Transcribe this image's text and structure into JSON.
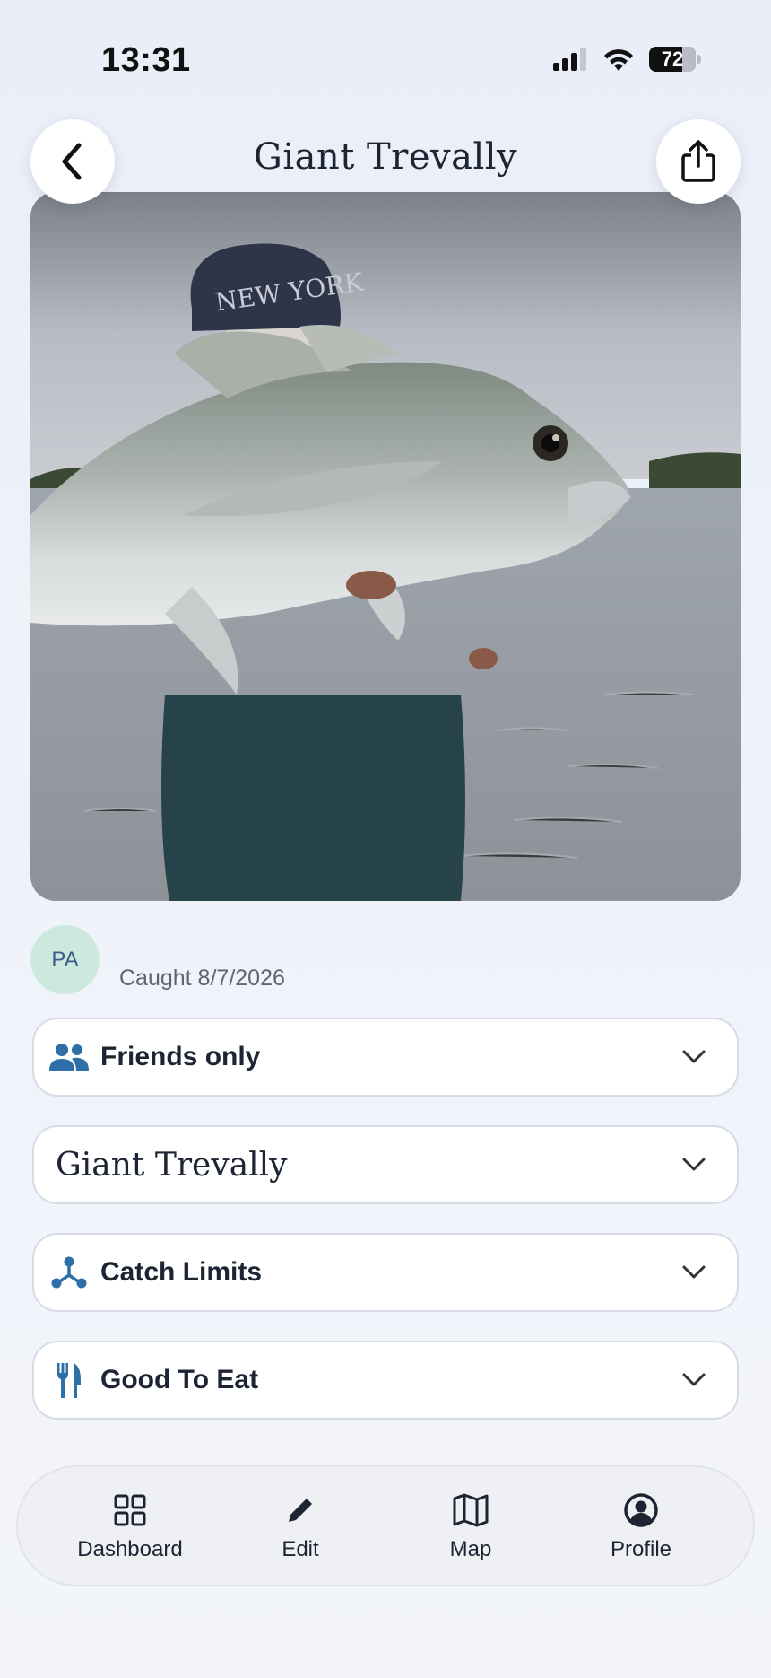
{
  "status_bar": {
    "time": "13:31",
    "battery_level": "72",
    "battery_fraction": 0.72
  },
  "header": {
    "title": "Giant Trevally",
    "back_icon": "chevron-left-icon",
    "share_icon": "share-icon"
  },
  "catch": {
    "avatar_initials": "PA",
    "caught_text": "Caught 8/7/2026"
  },
  "panels": [
    {
      "label": "Friends only",
      "icon": "friends-icon"
    },
    {
      "label": "Giant Trevally",
      "icon": ""
    },
    {
      "label": "Catch Limits",
      "icon": "hub-icon"
    },
    {
      "label": "Good To Eat",
      "icon": "utensils-icon"
    }
  ],
  "tabbar": {
    "items": [
      {
        "label": "Dashboard",
        "icon": "grid-icon"
      },
      {
        "label": "Edit",
        "icon": "pencil-icon"
      },
      {
        "label": "Map",
        "icon": "map-icon"
      },
      {
        "label": "Profile",
        "icon": "profile-icon"
      }
    ]
  },
  "colors": {
    "accent": "#2f6fa8",
    "avatar_bg": "#cde9de",
    "text": "#1d2433"
  }
}
